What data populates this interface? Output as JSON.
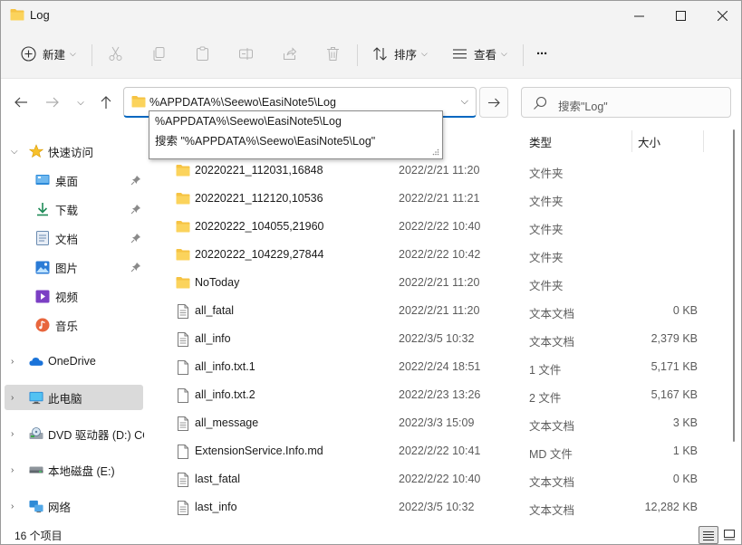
{
  "window": {
    "title": "Log"
  },
  "toolbar": {
    "new_label": "新建",
    "sort_label": "排序",
    "view_label": "查看",
    "more_label": "···"
  },
  "address": {
    "path": "%APPDATA%\\Seewo\\EasiNote5\\Log",
    "suggestions": [
      "%APPDATA%\\Seewo\\EasiNote5\\Log",
      "搜索 \"%APPDATA%\\Seewo\\EasiNote5\\Log\""
    ]
  },
  "search": {
    "placeholder": "搜索\"Log\""
  },
  "sidebar": {
    "items": [
      {
        "label": "快速访问",
        "icon": "star-icon"
      },
      {
        "label": "桌面",
        "icon": "desktop-icon",
        "pinned": true
      },
      {
        "label": "下载",
        "icon": "download-icon",
        "pinned": true
      },
      {
        "label": "文档",
        "icon": "document-icon",
        "pinned": true
      },
      {
        "label": "图片",
        "icon": "picture-icon",
        "pinned": true
      },
      {
        "label": "视频",
        "icon": "video-icon"
      },
      {
        "label": "音乐",
        "icon": "music-icon"
      },
      {
        "label": "OneDrive",
        "icon": "cloud-icon"
      },
      {
        "label": "此电脑",
        "icon": "computer-icon",
        "selected": true
      },
      {
        "label": "DVD 驱动器 (D:) CC",
        "icon": "dvd-icon"
      },
      {
        "label": "本地磁盘 (E:)",
        "icon": "drive-icon"
      },
      {
        "label": "网络",
        "icon": "network-icon"
      }
    ]
  },
  "columns": {
    "type": "类型",
    "size": "大小"
  },
  "files": [
    {
      "name": "20220221_112031,16848",
      "date": "2022/2/21 11:20",
      "type": "文件夹",
      "size": "",
      "kind": "folder"
    },
    {
      "name": "20220221_112120,10536",
      "date": "2022/2/21 11:21",
      "type": "文件夹",
      "size": "",
      "kind": "folder"
    },
    {
      "name": "20220222_104055,21960",
      "date": "2022/2/22 10:40",
      "type": "文件夹",
      "size": "",
      "kind": "folder"
    },
    {
      "name": "20220222_104229,27844",
      "date": "2022/2/22 10:42",
      "type": "文件夹",
      "size": "",
      "kind": "folder"
    },
    {
      "name": "NoToday",
      "date": "2022/2/21 11:20",
      "type": "文件夹",
      "size": "",
      "kind": "folder"
    },
    {
      "name": "all_fatal",
      "date": "2022/2/21 11:20",
      "type": "文本文档",
      "size": "0 KB",
      "kind": "text"
    },
    {
      "name": "all_info",
      "date": "2022/3/5 10:32",
      "type": "文本文档",
      "size": "2,379 KB",
      "kind": "text"
    },
    {
      "name": "all_info.txt.1",
      "date": "2022/2/24 18:51",
      "type": "1 文件",
      "size": "5,171 KB",
      "kind": "file"
    },
    {
      "name": "all_info.txt.2",
      "date": "2022/2/23 13:26",
      "type": "2 文件",
      "size": "5,167 KB",
      "kind": "file"
    },
    {
      "name": "all_message",
      "date": "2022/3/3 15:09",
      "type": "文本文档",
      "size": "3 KB",
      "kind": "text"
    },
    {
      "name": "ExtensionService.Info.md",
      "date": "2022/2/22 10:41",
      "type": "MD 文件",
      "size": "1 KB",
      "kind": "file"
    },
    {
      "name": "last_fatal",
      "date": "2022/2/22 10:40",
      "type": "文本文档",
      "size": "0 KB",
      "kind": "text"
    },
    {
      "name": "last_info",
      "date": "2022/3/5 10:32",
      "type": "文本文档",
      "size": "12,282 KB",
      "kind": "text"
    }
  ],
  "status": {
    "item_count": "16 个项目"
  },
  "colors": {
    "accent": "#0067c0",
    "folder": "#f6c343",
    "selected": "#dadada"
  }
}
